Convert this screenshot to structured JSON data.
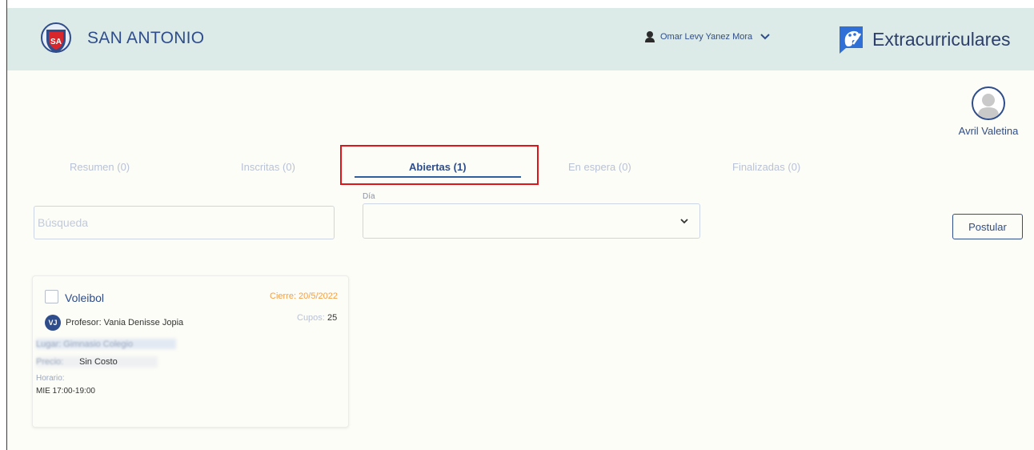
{
  "school": {
    "name": "SAN ANTONIO",
    "logo_icon": "school-shield-icon"
  },
  "user_menu": {
    "name": "Omar Levy Yanez Mora",
    "icon": "user-icon",
    "chevron": "chevron-down-icon"
  },
  "brand": {
    "name": "Extracurriculares",
    "logo_icon": "palette-icon",
    "color": "#2f4d8a"
  },
  "profile": {
    "name": "Avril Valetina",
    "icon": "avatar-icon"
  },
  "tabs": [
    {
      "label": "Resumen (0)",
      "active": false
    },
    {
      "label": "Inscritas (0)",
      "active": false
    },
    {
      "label": "Abiertas (1)",
      "active": true
    },
    {
      "label": "En espera (0)",
      "active": false
    },
    {
      "label": "Finalizadas (0)",
      "active": false
    }
  ],
  "search": {
    "placeholder": "Búsqueda",
    "value": ""
  },
  "filter": {
    "label": "Día",
    "value": ""
  },
  "actions": {
    "postular_label": "Postular"
  },
  "card": {
    "title": "Voleibol",
    "cierre": "Cierre: 20/5/2022",
    "teacher_initials": "VJ",
    "teacher": "Profesor: Vania Denisse Jopia",
    "cupos_label": "Cupos:",
    "cupos": "25",
    "location": "Lugar: Gimnasio Colegio",
    "cost_label": "Precio:",
    "cost": "Sin Costo",
    "horario_label": "Horario:",
    "horario": "MIE 17:00-19:00"
  },
  "colors": {
    "header_bg": "#dcebe8",
    "page_bg": "#fdfdf7",
    "primary": "#2f4d8a",
    "tab_inactive": "#b9c2d6",
    "highlight": "#e0141b",
    "cierre": "#f0a04b"
  }
}
